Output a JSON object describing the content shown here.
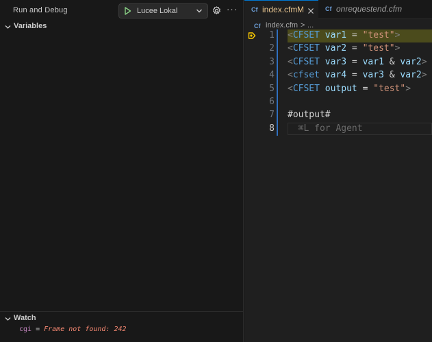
{
  "debug": {
    "title": "Run and Debug",
    "config": "Lucee Lokal",
    "more": "···"
  },
  "sections": {
    "variables": "Variables",
    "watch": "Watch"
  },
  "watch": {
    "name": "cgi",
    "eq": " = ",
    "value": "Frame not found: 242"
  },
  "tabs": [
    {
      "icon": "Cf",
      "label": "index.cfm",
      "modified": "M"
    },
    {
      "icon": "Cf",
      "label": "onrequestend.cfm"
    }
  ],
  "breadcrumb": {
    "file": "index.cfm",
    "sep": ">",
    "rest": "..."
  },
  "editor": {
    "lines": [
      {
        "n": "1",
        "tokens": [
          [
            "t-tag",
            "<"
          ],
          [
            "t-kw",
            "CFSET"
          ],
          [
            "t-op",
            " "
          ],
          [
            "t-var",
            "var1"
          ],
          [
            "t-op",
            " = "
          ],
          [
            "t-str",
            "\"test\""
          ],
          [
            "t-tag",
            ">"
          ]
        ]
      },
      {
        "n": "2",
        "tokens": [
          [
            "t-tag",
            "<"
          ],
          [
            "t-kw",
            "CFSET"
          ],
          [
            "t-op",
            " "
          ],
          [
            "t-var",
            "var2"
          ],
          [
            "t-op",
            " = "
          ],
          [
            "t-str",
            "\"test\""
          ],
          [
            "t-tag",
            ">"
          ]
        ]
      },
      {
        "n": "3",
        "tokens": [
          [
            "t-tag",
            "<"
          ],
          [
            "t-kw",
            "CFSET"
          ],
          [
            "t-op",
            " "
          ],
          [
            "t-var",
            "var3"
          ],
          [
            "t-op",
            " = "
          ],
          [
            "t-var",
            "var1"
          ],
          [
            "t-op",
            " & "
          ],
          [
            "t-var",
            "var2"
          ],
          [
            "t-tag",
            ">"
          ]
        ]
      },
      {
        "n": "4",
        "tokens": [
          [
            "t-tag",
            "<"
          ],
          [
            "t-kw",
            "cfset"
          ],
          [
            "t-op",
            " "
          ],
          [
            "t-var",
            "var4"
          ],
          [
            "t-op",
            " = "
          ],
          [
            "t-var",
            "var3"
          ],
          [
            "t-op",
            " & "
          ],
          [
            "t-var",
            "var2"
          ],
          [
            "t-tag",
            ">"
          ]
        ]
      },
      {
        "n": "5",
        "tokens": [
          [
            "t-tag",
            "<"
          ],
          [
            "t-kw",
            "CFSET"
          ],
          [
            "t-op",
            " "
          ],
          [
            "t-var",
            "output"
          ],
          [
            "t-op",
            " = "
          ],
          [
            "t-str",
            "\"test\""
          ],
          [
            "t-tag",
            ">"
          ]
        ]
      },
      {
        "n": "6",
        "tokens": []
      },
      {
        "n": "7",
        "tokens": [
          [
            "t-op",
            "#output#"
          ]
        ]
      },
      {
        "n": "8",
        "tokens": [
          [
            "ghost",
            "  ⌘L for Agent"
          ]
        ]
      }
    ],
    "current_line": "8",
    "paused_line": "1"
  },
  "colors": {
    "accent": "#0078d4",
    "modified": "#e2c08d",
    "debug_highlight": "#4b4b1c",
    "breakpoint": "#ffcc00"
  }
}
